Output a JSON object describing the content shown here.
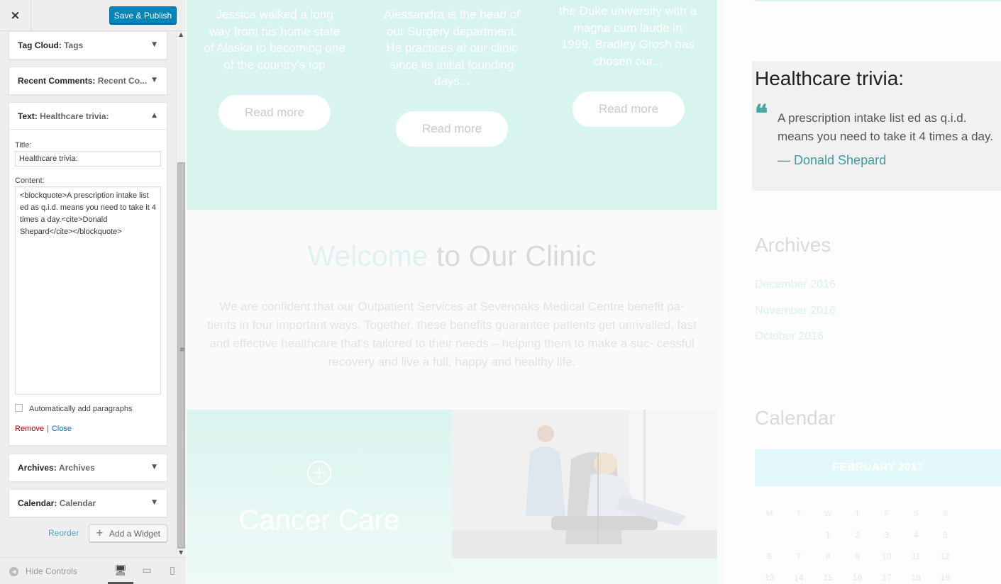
{
  "sidebar": {
    "close_icon": "×",
    "publish_label": "Save & Publish",
    "widgets_top": [
      {
        "type": "Tag Cloud:",
        "title": "Tags"
      },
      {
        "type": "Recent Comments:",
        "title": "Recent Co..."
      }
    ],
    "open_widget": {
      "type": "Text:",
      "title": "Healthcare trivia:",
      "title_label": "Title:",
      "title_value": "Healthcare trivia:",
      "content_label": "Content:",
      "content_value": "<blockquote>A prescription intake list ed as q.i.d. means you need to take it 4 times a day.<cite>Donald Shepard</cite></blockquote>",
      "autop_label": "Automatically add paragraphs",
      "remove_label": "Remove",
      "separator": "|",
      "close_label": "Close"
    },
    "widgets_bottom": [
      {
        "type": "Archives:",
        "title": "Archives"
      },
      {
        "type": "Calendar:",
        "title": "Calendar"
      }
    ],
    "reorder_label": "Reorder",
    "add_widget_label": "Add a Widget",
    "hide_controls_label": "Hide Controls"
  },
  "preview": {
    "team": [
      {
        "text": "Jessica walked a long way from his home state of Alaska to becoming one of the country's top",
        "button": "Read more"
      },
      {
        "text": "Alessandra is the head of our Surgery department. He practices at our clinic since its initial founding days...",
        "button": "Read more"
      },
      {
        "text": "the Duke university with a magna cum laude in 1999, Bradley Grosh has chosen our...",
        "button": "Read more"
      }
    ],
    "welcome": {
      "title_accent": "Welcome",
      "title_rest": " to Our Clinic",
      "text": "We are confident that our Outpatient Services at Sevenoaks Medical Centre benefit pa- tients in four important ways. Together, these benefits guarantee patients get unrivalled, fast and effective healthcare that's tailored to their needs – helping them to make a suc- cessful recovery and live a full, happy and healthy life."
    },
    "service": {
      "title": "Cancer Care"
    },
    "trivia": {
      "title": "Healthcare trivia:",
      "quote": "A prescription intake list ed as q.i.d. means you need to take it 4 times a day.",
      "cite": "— Donald Shepard"
    },
    "archives": {
      "title": "Archives",
      "links": [
        "December 2016",
        "November 2016",
        "October 2016"
      ]
    },
    "calendar": {
      "title": "Calendar",
      "month": "FEBRUARY 2017",
      "weekdays": [
        "M",
        "T",
        "W",
        "T",
        "F",
        "S",
        "S"
      ],
      "rows": [
        [
          "",
          "",
          "1",
          "2",
          "3",
          "4",
          "5"
        ],
        [
          "6",
          "7",
          "8",
          "9",
          "10",
          "11",
          "12"
        ],
        [
          "13",
          "14",
          "15",
          "16",
          "17",
          "18",
          "19"
        ]
      ]
    }
  },
  "colors": {
    "publish": "#0085ba",
    "accent": "#4aa4a4",
    "band": "#d8f4ee"
  }
}
